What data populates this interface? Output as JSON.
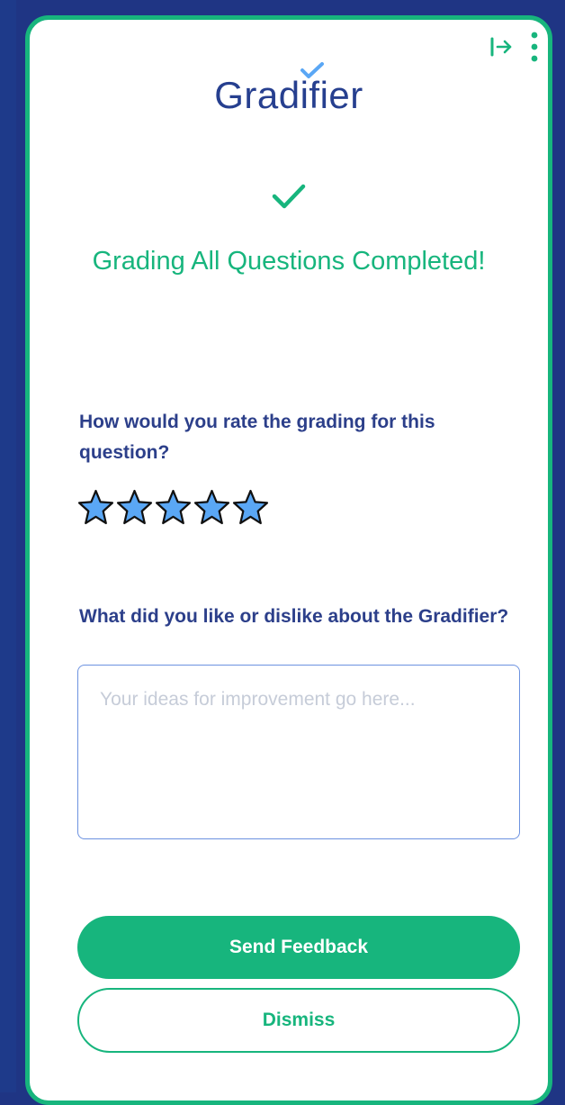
{
  "app": {
    "logo_text": "Gradifier"
  },
  "header_actions": {
    "collapse_icon": "arrow-right-to-bar-icon",
    "menu_icon": "more-vertical-icon"
  },
  "status": {
    "icon": "check-icon",
    "title": "Grading All Questions Completed!"
  },
  "rating": {
    "question": "How would you rate the grading for this question?",
    "max_stars": 5,
    "selected": 0
  },
  "feedback": {
    "question": "What did you like or dislike about the Gradifier?",
    "value": "",
    "placeholder": "Your ideas for improvement go here..."
  },
  "actions": {
    "send_label": "Send Feedback",
    "dismiss_label": "Dismiss"
  },
  "colors": {
    "accent": "#17b57d",
    "brand": "#263f8f",
    "background": "#1f3584",
    "star_fill": "#5aa7f5"
  }
}
